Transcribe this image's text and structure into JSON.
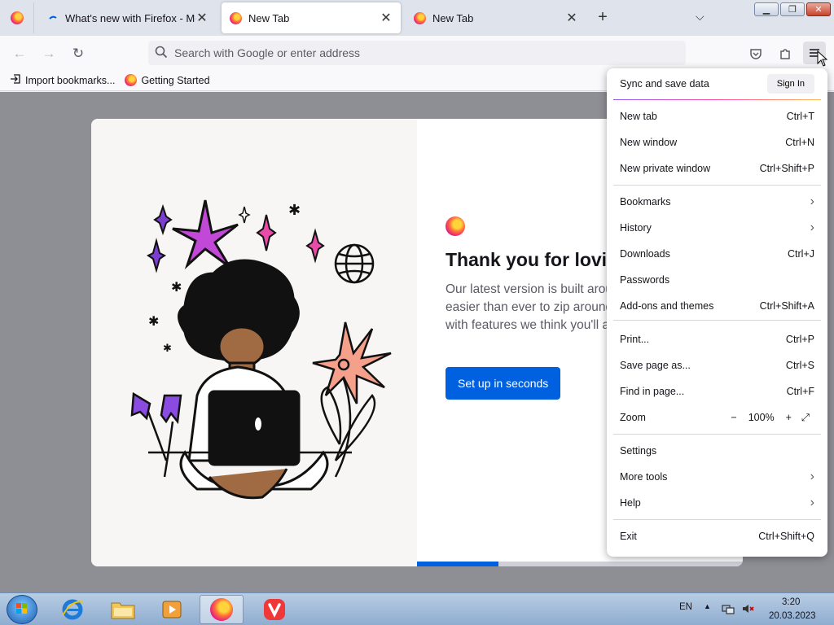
{
  "tabs": [
    {
      "title": "What's new with Firefox - More",
      "selected": false
    },
    {
      "title": "New Tab",
      "selected": true
    },
    {
      "title": "New Tab",
      "selected": false
    }
  ],
  "new_tab_symbol": "+",
  "list_tabs_symbol": "⌵",
  "window_controls": {
    "minimize": "▁",
    "restore": "❐",
    "close": "✕"
  },
  "navbar": {
    "back": "←",
    "forward": "→",
    "reload": "↻",
    "search_placeholder": "Search with Google or enter address"
  },
  "bookmarks": [
    {
      "label": "Import bookmarks...",
      "icon": "import-icon"
    },
    {
      "label": "Getting Started",
      "icon": "firefox-icon"
    }
  ],
  "onboarding": {
    "heading": "Thank you for lovin",
    "body_lines": [
      "Our latest version is built aroun",
      "easier than ever to zip around",
      "with features we think you'll ad"
    ],
    "button": "Set up in seconds",
    "progress_fraction": 0.25
  },
  "menu": {
    "sync_label": "Sync and save data",
    "sign_in": "Sign In",
    "items": [
      {
        "label": "New tab",
        "shortcut": "Ctrl+T"
      },
      {
        "label": "New window",
        "shortcut": "Ctrl+N"
      },
      {
        "label": "New private window",
        "shortcut": "Ctrl+Shift+P"
      },
      {
        "label": "Bookmarks",
        "shortcut": ""
      },
      {
        "label": "History",
        "shortcut": ""
      },
      {
        "label": "Downloads",
        "shortcut": "Ctrl+J"
      },
      {
        "label": "Passwords",
        "shortcut": ""
      },
      {
        "label": "Add-ons and themes",
        "shortcut": "Ctrl+Shift+A"
      },
      {
        "label": "Print...",
        "shortcut": "Ctrl+P"
      },
      {
        "label": "Save page as...",
        "shortcut": "Ctrl+S"
      },
      {
        "label": "Find in page...",
        "shortcut": "Ctrl+F"
      },
      {
        "label": "Zoom",
        "shortcut": ""
      },
      {
        "label": "Settings",
        "shortcut": ""
      },
      {
        "label": "More tools",
        "shortcut": ""
      },
      {
        "label": "Help",
        "shortcut": ""
      },
      {
        "label": "Exit",
        "shortcut": "Ctrl+Shift+Q"
      }
    ],
    "zoom": {
      "minus": "−",
      "level": "100%",
      "plus": "+",
      "fullscreen": "⤢"
    },
    "chevron": "›"
  },
  "taskbar": {
    "language": "EN",
    "time": "3:20",
    "date": "20.03.2023"
  },
  "colors": {
    "accent_blue": "#0061e0",
    "menu_accent_start": "#9059ff",
    "menu_accent_end": "#ffbd4f",
    "vivaldi_red": "#ef3939"
  }
}
